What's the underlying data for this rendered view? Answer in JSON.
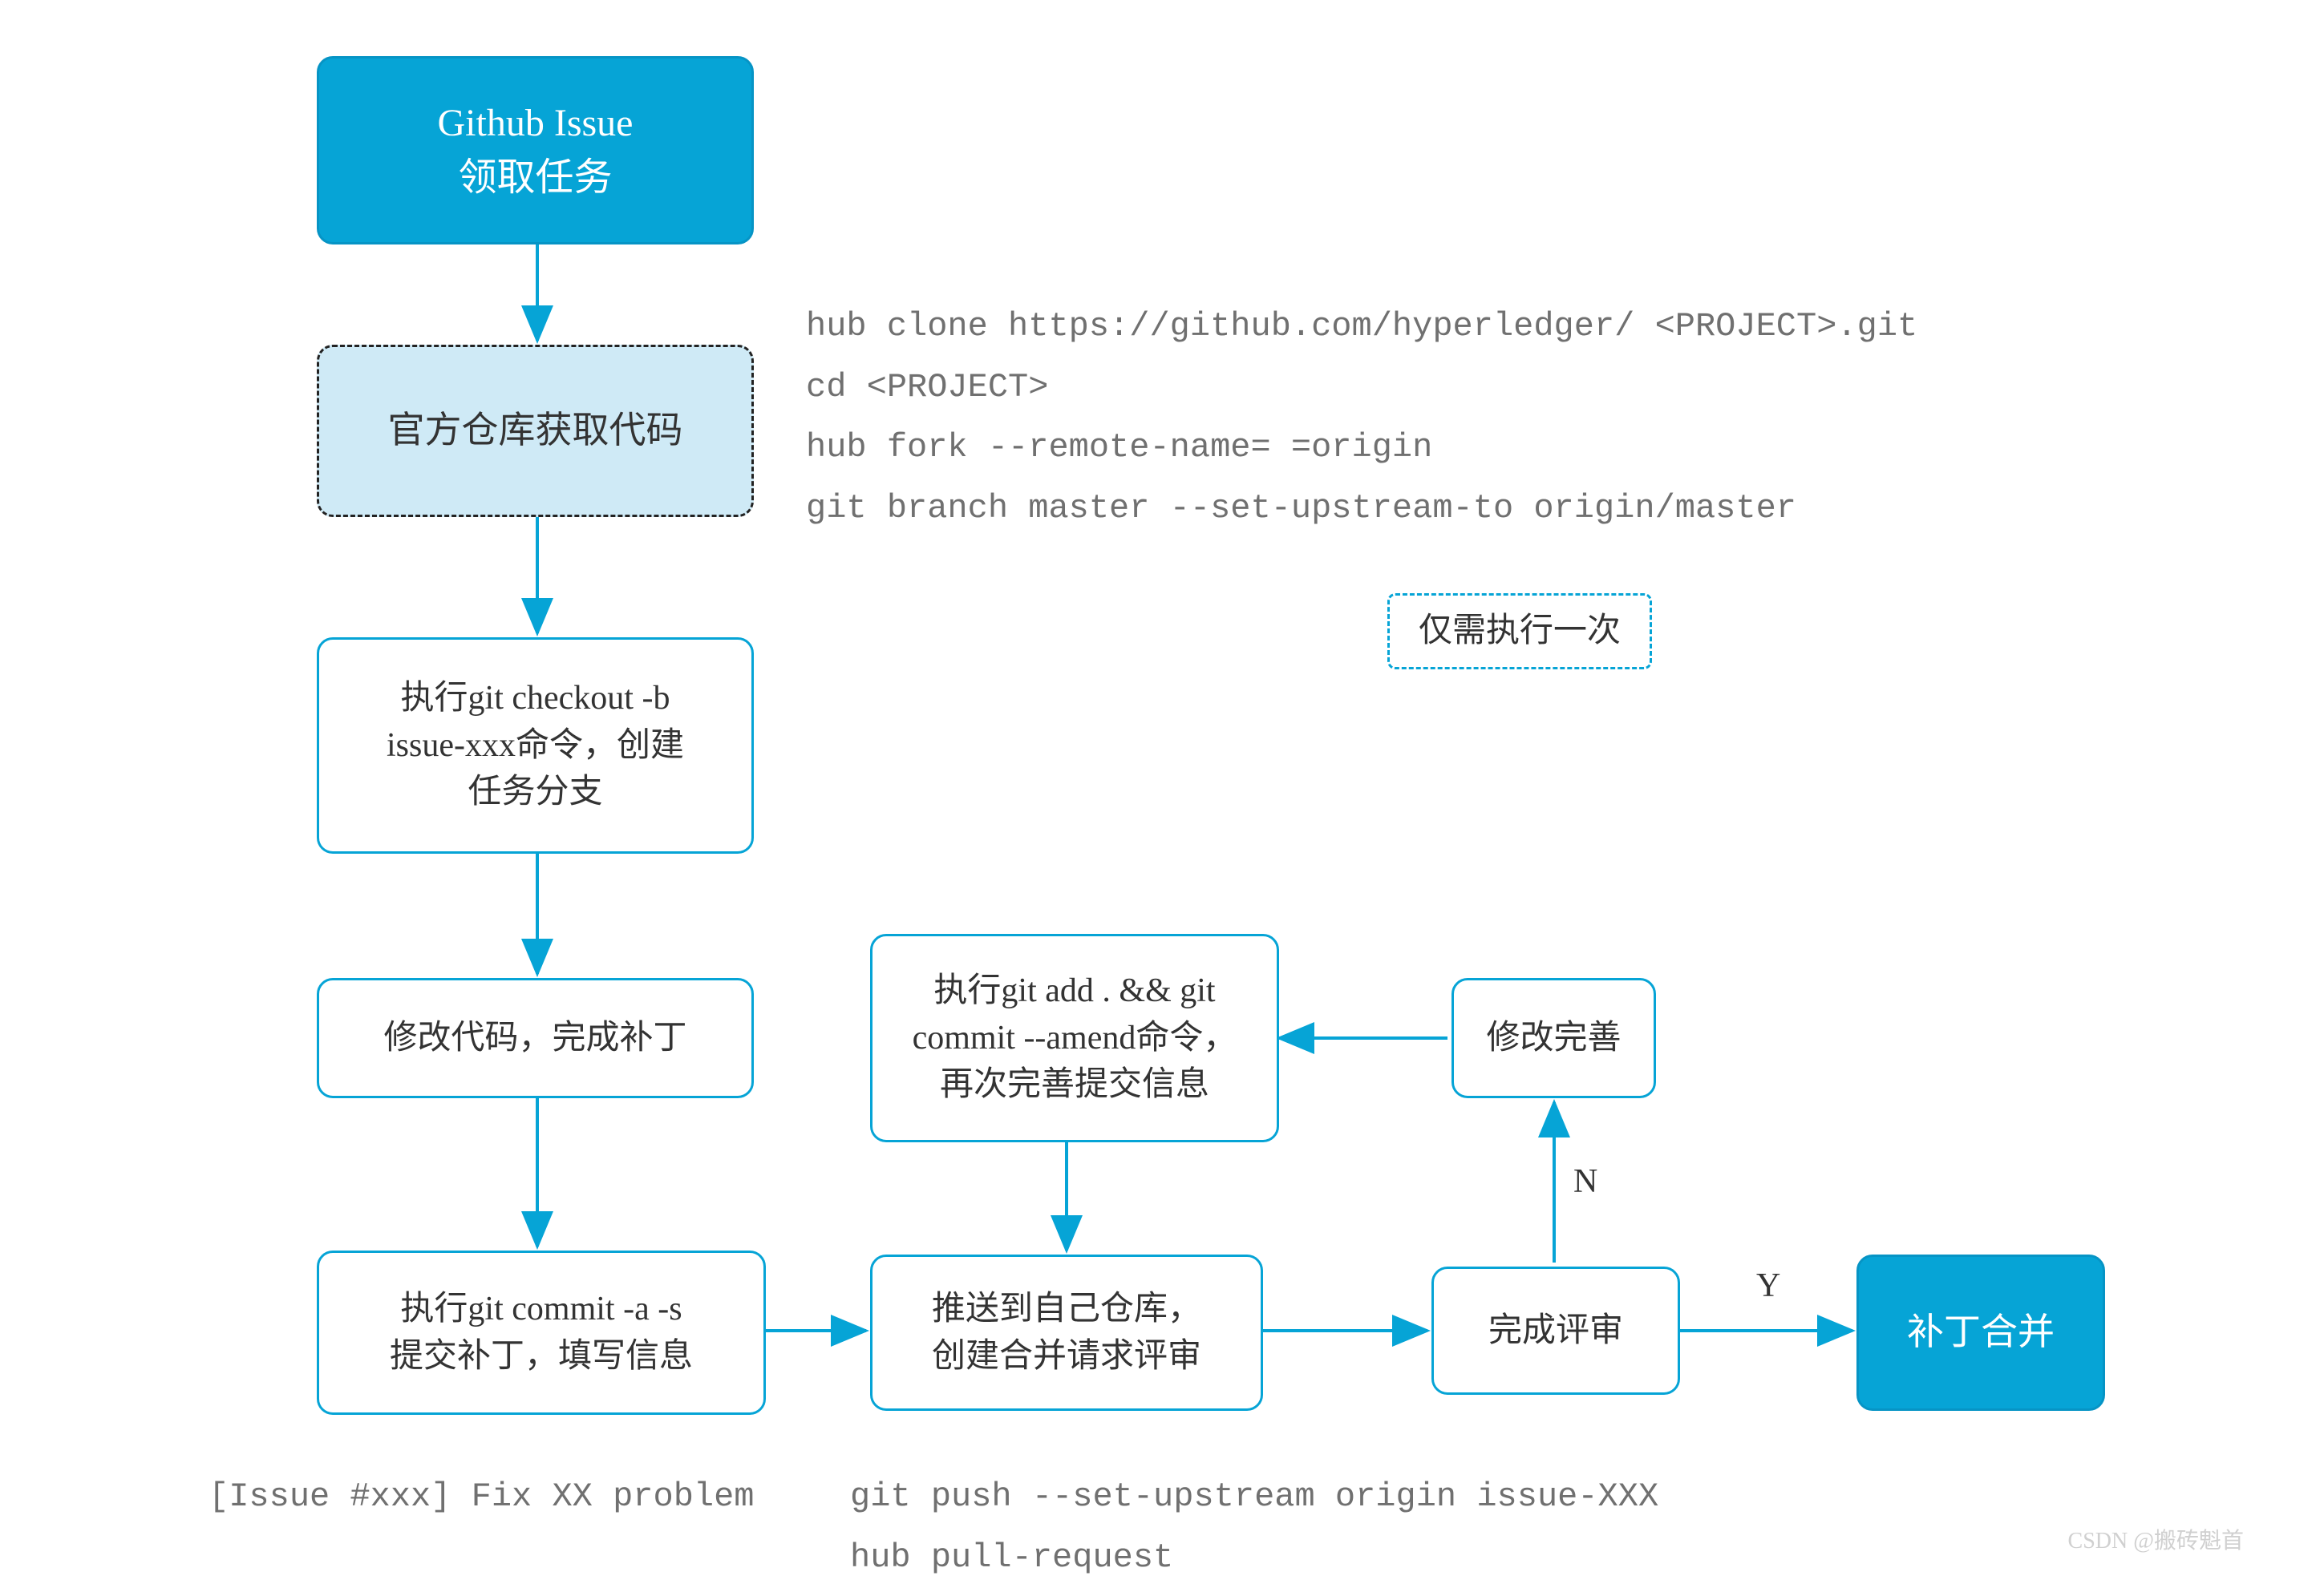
{
  "nodes": {
    "start": {
      "line1": "Github Issue",
      "line2": "领取任务"
    },
    "fetch": {
      "text": "官方仓库获取代码"
    },
    "checkout": {
      "line1": "执行git checkout -b",
      "line2": "issue-xxx命令，创建",
      "line3": "任务分支"
    },
    "modify": {
      "text": "修改代码，完成补丁"
    },
    "commit": {
      "line1": "执行git commit -a -s",
      "line2": "提交补丁，填写信息"
    },
    "amend": {
      "line1": "执行git add . && git",
      "line2": "commit --amend命令，",
      "line3": "再次完善提交信息"
    },
    "improve": {
      "text": "修改完善"
    },
    "push": {
      "line1": "推送到自己仓库，",
      "line2": "创建合并请求评审"
    },
    "review": {
      "text": "完成评审"
    },
    "merge": {
      "text": "补丁合并"
    },
    "once": {
      "text": "仅需执行一次"
    }
  },
  "labels": {
    "Y": "Y",
    "N": "N"
  },
  "code": {
    "clone": "hub clone https://github.com/hyperledger/ <PROJECT>.git\ncd <PROJECT>\nhub fork --remote-name= =origin\ngit branch master --set-upstream-to origin/master",
    "issue": "[Issue #xxx] Fix XX problem",
    "push": "git push --set-upstream origin issue-XXX\nhub pull-request"
  },
  "watermark": "CSDN @搬砖魁首"
}
